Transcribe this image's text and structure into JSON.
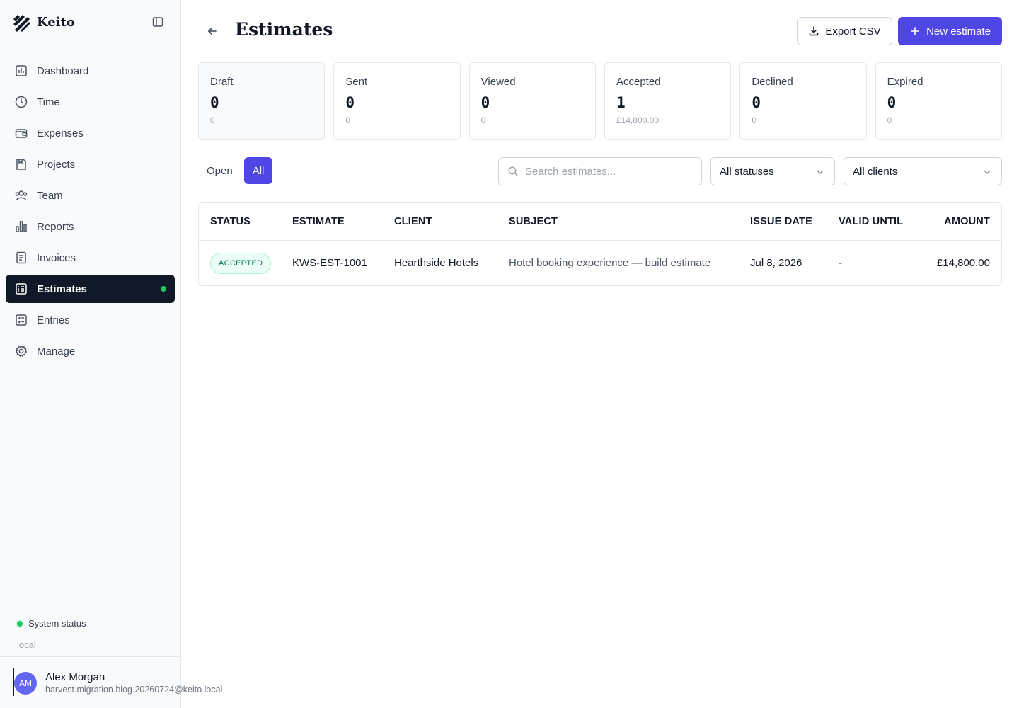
{
  "app": {
    "name": "Keito"
  },
  "sidebar": {
    "items": [
      {
        "label": "Dashboard",
        "icon": "dashboard-icon"
      },
      {
        "label": "Time",
        "icon": "clock-icon"
      },
      {
        "label": "Expenses",
        "icon": "wallet-icon"
      },
      {
        "label": "Projects",
        "icon": "folder-icon"
      },
      {
        "label": "Team",
        "icon": "users-icon"
      },
      {
        "label": "Reports",
        "icon": "bar-chart-icon"
      },
      {
        "label": "Invoices",
        "icon": "invoice-icon"
      },
      {
        "label": "Estimates",
        "icon": "list-icon",
        "active": true
      },
      {
        "label": "Entries",
        "icon": "checklist-icon"
      },
      {
        "label": "Manage",
        "icon": "gear-icon"
      }
    ],
    "system_status": "System status",
    "environment": "local",
    "user": {
      "initials": "AM",
      "name": "Alex Morgan",
      "email": "harvest.migration.blog.20260724@keito.local"
    }
  },
  "header": {
    "title": "Estimates",
    "export_label": "Export CSV",
    "new_label": "New estimate"
  },
  "cards": [
    {
      "label": "Draft",
      "count": "0",
      "amount": "0"
    },
    {
      "label": "Sent",
      "count": "0",
      "amount": "0"
    },
    {
      "label": "Viewed",
      "count": "0",
      "amount": "0"
    },
    {
      "label": "Accepted",
      "count": "1",
      "amount": "£14,800.00"
    },
    {
      "label": "Declined",
      "count": "0",
      "amount": "0"
    },
    {
      "label": "Expired",
      "count": "0",
      "amount": "0"
    }
  ],
  "filters": {
    "tabs": [
      {
        "label": "Open"
      },
      {
        "label": "All",
        "active": true
      }
    ],
    "search_placeholder": "Search estimates...",
    "status_value": "All statuses",
    "client_value": "All clients"
  },
  "table": {
    "columns": [
      "STATUS",
      "ESTIMATE",
      "CLIENT",
      "SUBJECT",
      "ISSUE DATE",
      "VALID UNTIL",
      "AMOUNT"
    ],
    "rows": [
      {
        "status": "ACCEPTED",
        "estimate": "KWS-EST-1001",
        "client": "Hearthside Hotels",
        "subject": "Hotel booking experience — build estimate",
        "issue_date": "Jul 8, 2026",
        "valid_until": "-",
        "amount": "£14,800.00"
      }
    ]
  },
  "colors": {
    "accent": "#4f46e5",
    "active_nav": "#111827",
    "success": "#22c55e"
  }
}
